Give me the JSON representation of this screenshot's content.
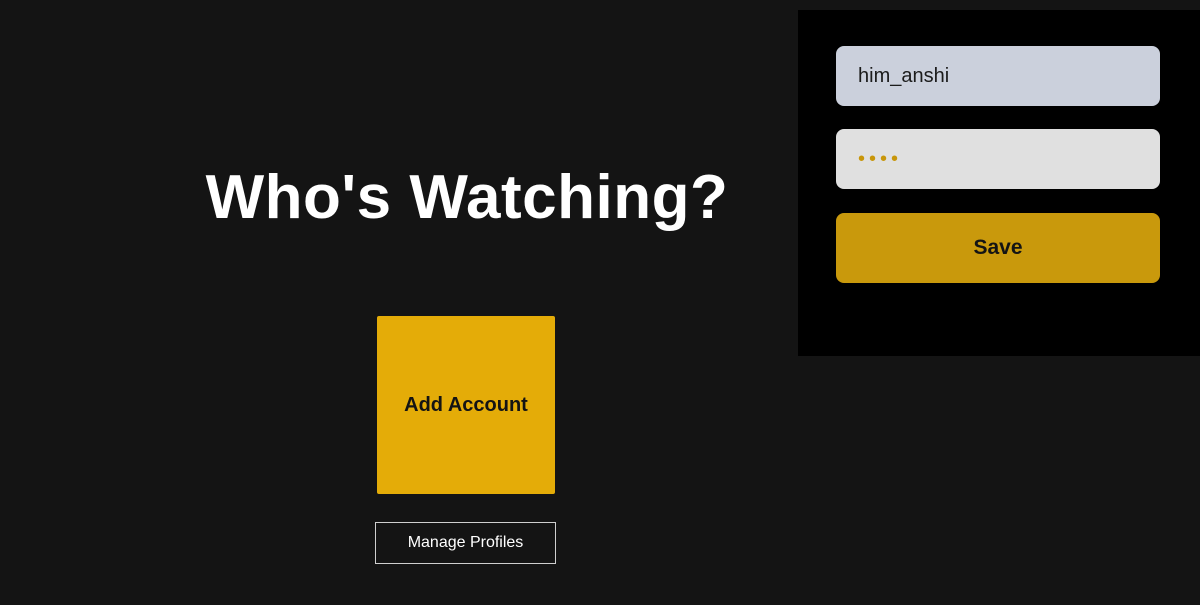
{
  "main": {
    "title": "Who's Watching?",
    "add_account_label": "Add Account",
    "manage_profiles_label": "Manage Profiles"
  },
  "login_panel": {
    "username_value": "him_anshi",
    "password_value": "••••",
    "save_label": "Save"
  },
  "colors": {
    "background": "#141414",
    "accent": "#e4ac08",
    "save_button": "#c9990c",
    "panel": "#000000"
  }
}
